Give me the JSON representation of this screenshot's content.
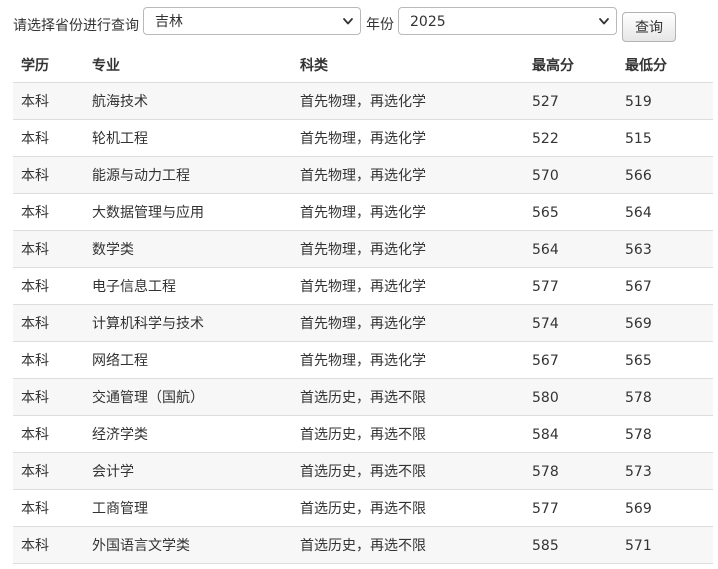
{
  "filter": {
    "prompt_label": "请选择省份进行查询",
    "province_value": "吉林",
    "year_label": "年份",
    "year_value": "2025",
    "query_button": "查询"
  },
  "table": {
    "headers": [
      "学历",
      "专业",
      "科类",
      "最高分",
      "最低分"
    ],
    "rows": [
      [
        "本科",
        "航海技术",
        "首先物理，再选化学",
        "527",
        "519"
      ],
      [
        "本科",
        "轮机工程",
        "首先物理，再选化学",
        "522",
        "515"
      ],
      [
        "本科",
        "能源与动力工程",
        "首先物理，再选化学",
        "570",
        "566"
      ],
      [
        "本科",
        "大数据管理与应用",
        "首先物理，再选化学",
        "565",
        "564"
      ],
      [
        "本科",
        "数学类",
        "首先物理，再选化学",
        "564",
        "563"
      ],
      [
        "本科",
        "电子信息工程",
        "首先物理，再选化学",
        "577",
        "567"
      ],
      [
        "本科",
        "计算机科学与技术",
        "首先物理，再选化学",
        "574",
        "569"
      ],
      [
        "本科",
        "网络工程",
        "首先物理，再选化学",
        "567",
        "565"
      ],
      [
        "本科",
        "交通管理（国航）",
        "首选历史，再选不限",
        "580",
        "578"
      ],
      [
        "本科",
        "经济学类",
        "首选历史，再选不限",
        "584",
        "578"
      ],
      [
        "本科",
        "会计学",
        "首选历史，再选不限",
        "578",
        "573"
      ],
      [
        "本科",
        "工商管理",
        "首选历史，再选不限",
        "577",
        "569"
      ],
      [
        "本科",
        "外国语言文学类",
        "首选历史，再选不限",
        "585",
        "571"
      ]
    ]
  },
  "icons": {
    "province_select_arrow": "chevron-down-icon",
    "year_select_arrow": "chevron-down-icon"
  },
  "colors": {
    "row_stripe": "#f7f7f7",
    "border": "#dddddd",
    "text": "#333333"
  }
}
